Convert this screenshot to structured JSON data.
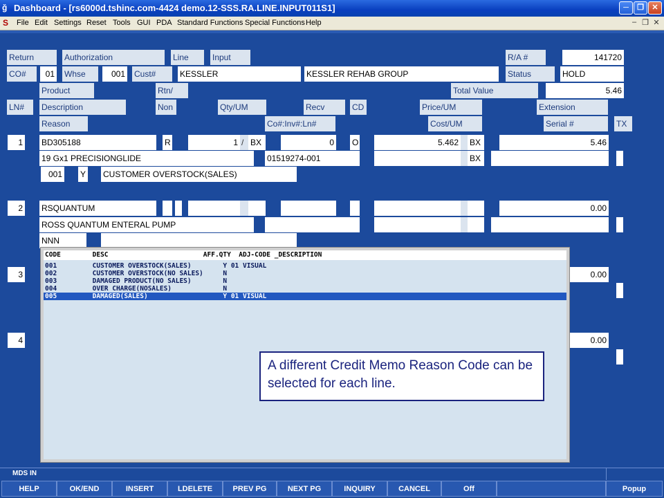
{
  "window": {
    "title": "Dashboard - [rs6000d.tshinc.com-4424 demo.12-SSS.RA.LINE.INPUT011S1]",
    "app_icon": "ǧ",
    "logo": "S"
  },
  "menu": [
    "File",
    "Edit",
    "Settings",
    "Reset",
    "Tools",
    "GUI",
    "PDA",
    "Standard Functions",
    "Special Functions",
    "Help"
  ],
  "header": {
    "return_label": "Return",
    "authorization_label": "Authorization",
    "line_label": "Line",
    "input_label": "Input",
    "ra_label": "R/A #",
    "ra_value": "141720",
    "co_label": "CO#",
    "co_value": "01",
    "whse_label": "Whse",
    "whse_value": "001",
    "cust_label": "Cust#",
    "cust_value": "KESSLER",
    "cust_name": "KESSLER REHAB GROUP",
    "status_label": "Status",
    "status_value": "HOLD",
    "product_label": "Product",
    "rtn_label": "Rtn/",
    "total_value_label": "Total Value",
    "total_value": "5.46",
    "ln_label": "LN#",
    "description_label": "Description",
    "non_label": "Non",
    "qty_um_label": "Qty/UM",
    "recv_label": "Recv",
    "cd_label": "CD",
    "price_um_label": "Price/UM",
    "extension_label": "Extension",
    "reason_label": "Reason",
    "co_inv_ln_label": "Co#:Inv#:Ln#",
    "cost_um_label": "Cost/UM",
    "serial_label": "Serial #",
    "tx_label": "TX"
  },
  "lines": [
    {
      "ln": "1",
      "product": "BD305188",
      "non": "R",
      "qty": "1",
      "slash": "/",
      "um": "BX",
      "recv": "0",
      "cd": "O",
      "price": "5.462",
      "price_um": "BX",
      "extension": "5.46",
      "description": "19 Gx1 PRECISIONGLIDE",
      "invoice": "01519274-001",
      "cost_um": "BX",
      "reason_code": "001",
      "reason_flag": "Y",
      "reason_desc": "CUSTOMER OVERSTOCK(SALES)"
    },
    {
      "ln": "2",
      "product": "RSQUANTUM",
      "extension": "0.00",
      "description": "ROSS QUANTUM ENTERAL PUMP",
      "reason_code": "NNN"
    },
    {
      "ln": "3",
      "extension": "0.00"
    },
    {
      "ln": "4",
      "extension": "0.00"
    }
  ],
  "popup": {
    "header": "CODE        DESC                        AFF.QTY  ADJ-CODE _DESCRIPTION",
    "rows": [
      "001         CUSTOMER OVERSTOCK(SALES)        Y 01 VISUAL",
      "002         CUSTOMER OVERSTOCK(NO SALES)     N",
      "003         DAMAGED PRODUCT(NO SALES)        N",
      "004         OVER CHARGE(NOSALES)             N",
      "005         DAMAGED(SALES)                   Y 01 VISUAL"
    ],
    "selected_index": 4
  },
  "note": "A different Credit Memo Reason Code can be selected for each line.",
  "status_bar": {
    "text": "MDS IN"
  },
  "function_keys": [
    "HELP",
    "OK/END",
    "INSERT",
    "LDELETE",
    "PREV PG",
    "NEXT PG",
    "INQUIRY",
    "CANCEL",
    "Off",
    "",
    "Popup"
  ]
}
